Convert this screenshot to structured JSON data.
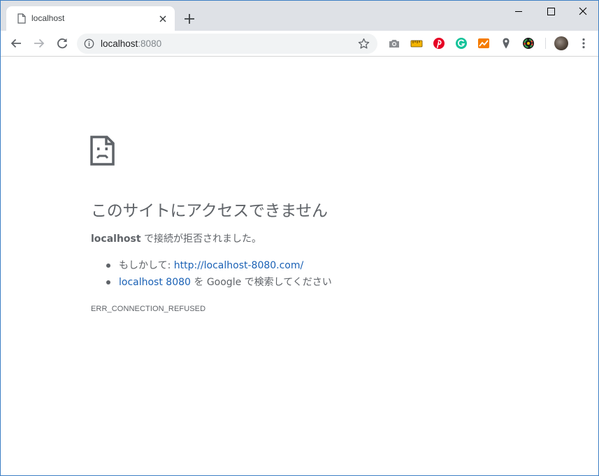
{
  "tab": {
    "title": "localhost"
  },
  "omnibox": {
    "host": "localhost",
    "port": ":8080"
  },
  "toolbar": {
    "extensions": [
      "camera-icon",
      "ruler-extension-icon",
      "pinterest-icon",
      "grammarly-icon",
      "analytics-extension-icon",
      "map-pin-icon",
      "color-picker-icon"
    ]
  },
  "error": {
    "heading": "このサイトにアクセスできません",
    "host": "localhost",
    "message": " で接続が拒否されました。",
    "suggestion1_prefix": "もしかして: ",
    "suggestion1_link": "http://localhost-8080.com/",
    "suggestion2_link": "localhost 8080",
    "suggestion2_suffix": " を Google で検索してください",
    "code": "ERR_CONNECTION_REFUSED"
  },
  "colors": {
    "tabstrip": "#dee1e6",
    "link": "#1a61b5",
    "text": "#5f6368",
    "window_border": "#3c7fc4"
  }
}
